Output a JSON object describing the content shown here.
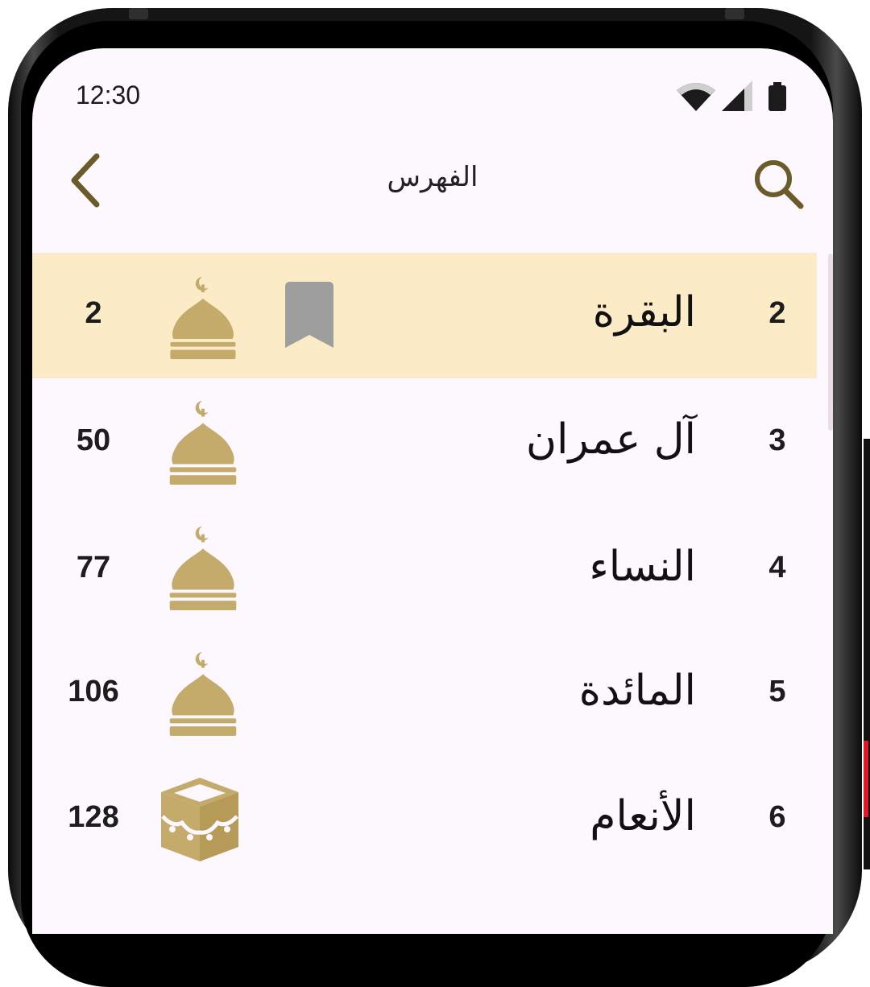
{
  "status_bar": {
    "time": "12:30"
  },
  "header": {
    "title": "الفهرس"
  },
  "colors": {
    "accent": "#6b5a2a",
    "highlight": "#fbebc7",
    "icon_gold": "#c4aa6b",
    "bookmark": "#9e9e9e"
  },
  "surahs": [
    {
      "number": "2",
      "name": "البقرة",
      "page": "2",
      "place": "mosque-icon",
      "bookmarked": true,
      "selected": true
    },
    {
      "number": "3",
      "name": "آل عمران",
      "page": "50",
      "place": "mosque-icon",
      "bookmarked": false,
      "selected": false
    },
    {
      "number": "4",
      "name": "النساء",
      "page": "77",
      "place": "mosque-icon",
      "bookmarked": false,
      "selected": false
    },
    {
      "number": "5",
      "name": "المائدة",
      "page": "106",
      "place": "mosque-icon",
      "bookmarked": false,
      "selected": false
    },
    {
      "number": "6",
      "name": "الأنعام",
      "page": "128",
      "place": "kaaba-icon",
      "bookmarked": false,
      "selected": false
    }
  ]
}
